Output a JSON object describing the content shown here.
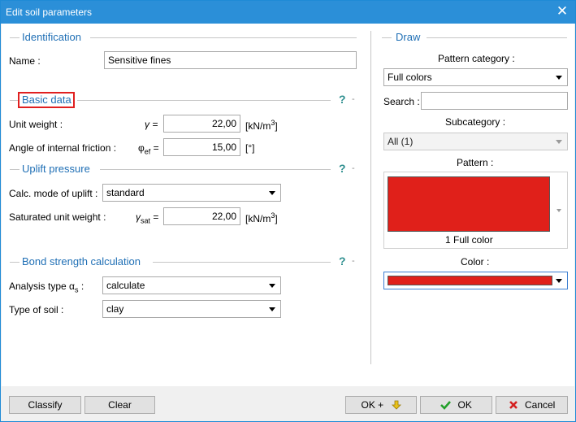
{
  "window": {
    "title": "Edit soil parameters",
    "close_glyph": "✕"
  },
  "identification": {
    "section_title": "Identification",
    "name_label": "Name :",
    "name_value": "Sensitive fines"
  },
  "basic_data": {
    "section_title": "Basic data",
    "help": "?",
    "unit_weight_label": "Unit weight :",
    "unit_weight_symbol": "γ =",
    "unit_weight_value": "22,00",
    "unit_weight_unit": "[kN/m",
    "unit_weight_unit_sup": "3",
    "unit_weight_unit_end": "]",
    "friction_label": "Angle of internal friction :",
    "friction_symbol": "φ",
    "friction_symbol_sub": "ef",
    "friction_symbol_eq": "=",
    "friction_value": "15,00",
    "friction_unit": "[°]"
  },
  "uplift": {
    "section_title": "Uplift pressure",
    "help": "?",
    "mode_label": "Calc. mode of uplift :",
    "mode_value": "standard",
    "sat_label": "Saturated unit weight :",
    "sat_symbol": "γ",
    "sat_symbol_sub": "sat",
    "sat_symbol_eq": "=",
    "sat_value": "22,00",
    "sat_unit": "[kN/m",
    "sat_unit_sup": "3",
    "sat_unit_end": "]"
  },
  "bond": {
    "section_title": "Bond strength calculation",
    "help": "?",
    "analysis_label": "Analysis type α",
    "analysis_label_sub": "s",
    "analysis_label_end": ":",
    "analysis_value": "calculate",
    "soil_label": "Type of soil :",
    "soil_value": "clay"
  },
  "draw": {
    "section_title": "Draw",
    "pattern_category_label": "Pattern category :",
    "pattern_category_value": "Full colors",
    "search_label": "Search :",
    "search_value": "",
    "subcategory_label": "Subcategory :",
    "subcategory_value": "All (1)",
    "pattern_label": "Pattern :",
    "pattern_caption": "1 Full color",
    "color_label": "Color :",
    "fill_color": "#e0201a"
  },
  "buttons": {
    "classify": "Classify",
    "clear": "Clear",
    "ok_plus": "OK +",
    "ok": "OK",
    "cancel": "Cancel"
  },
  "icons": [
    "close-icon",
    "help-icon",
    "dropdown-arrow-icon",
    "arrow-down-icon",
    "checkmark-icon",
    "cancel-x-icon"
  ]
}
